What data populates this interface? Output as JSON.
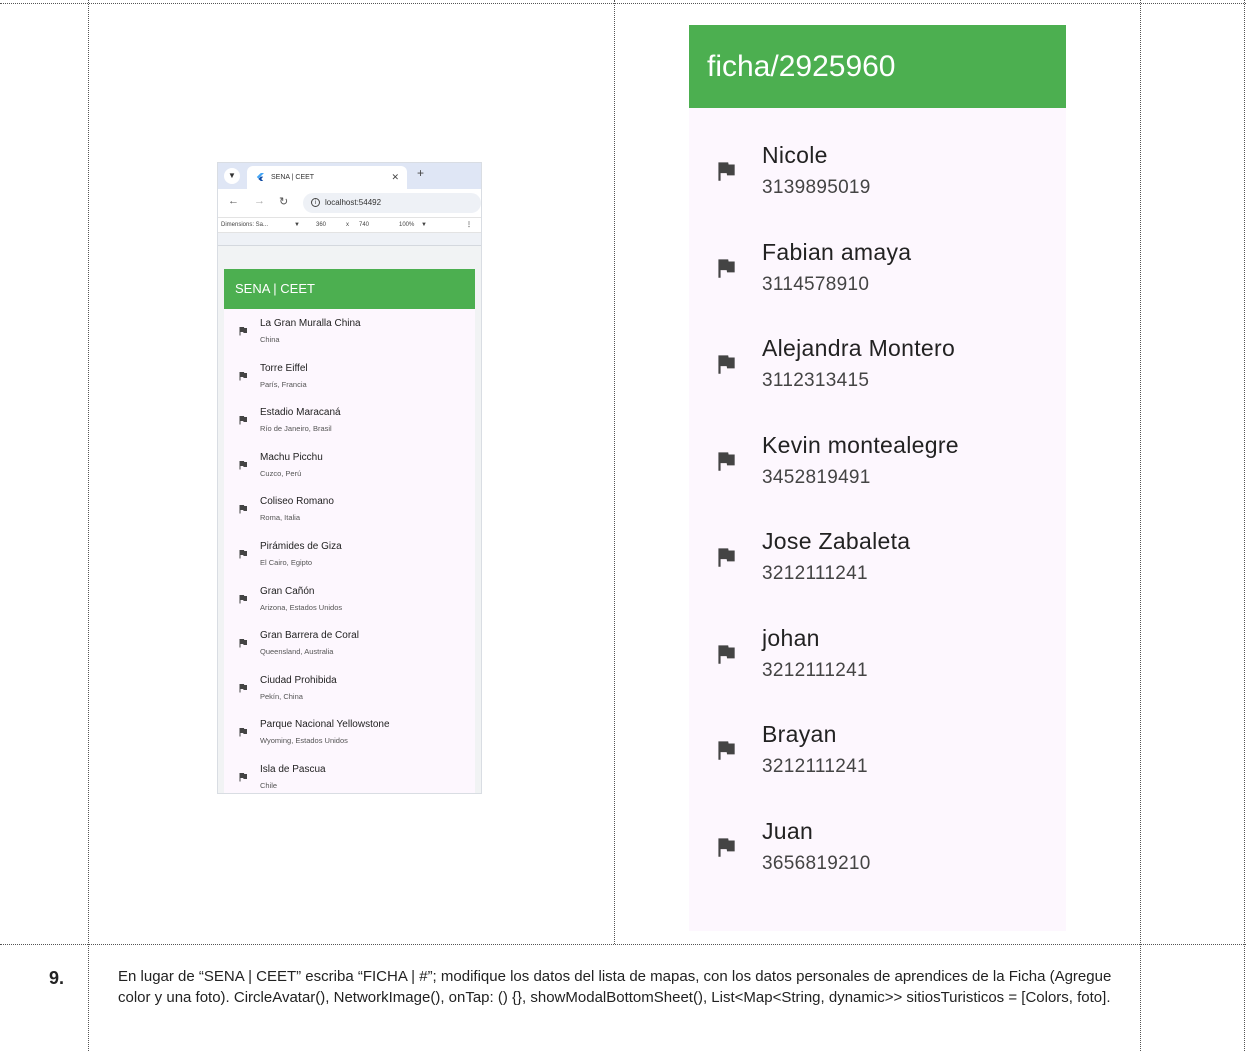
{
  "row_number": "9.",
  "instructions": "En lugar de “SENA | CEET” escriba “FICHA | #”; modifique los datos del lista de mapas, con los datos personales de aprendices de la Ficha (Agregue color y una foto). CircleAvatar(), NetworkImage(), onTap: () {}, showModalBottomSheet(),  List<Map<String, dynamic>> sitiosTuristicos = [Colors, foto].",
  "browser": {
    "tab_title": "SENA | CEET",
    "url": "localhost:54492",
    "devtools": {
      "dimensions": "Dimensions: Sa...",
      "width": "360",
      "times": "x",
      "height": "740",
      "zoom": "100%"
    },
    "app_title": "SENA | CEET",
    "items": [
      {
        "title": "La Gran Muralla China",
        "subtitle": "China"
      },
      {
        "title": "Torre Eiffel",
        "subtitle": "París, Francia"
      },
      {
        "title": "Estadio Maracaná",
        "subtitle": "Río de Janeiro, Brasil"
      },
      {
        "title": "Machu Picchu",
        "subtitle": "Cuzco, Perú"
      },
      {
        "title": "Coliseo Romano",
        "subtitle": "Roma, Italia"
      },
      {
        "title": "Pirámides de Giza",
        "subtitle": "El Cairo, Egipto"
      },
      {
        "title": "Gran Cañón",
        "subtitle": "Arizona, Estados Unidos"
      },
      {
        "title": "Gran Barrera de Coral",
        "subtitle": "Queensland, Australia"
      },
      {
        "title": "Ciudad Prohibida",
        "subtitle": "Pekín, China"
      },
      {
        "title": "Parque Nacional Yellowstone",
        "subtitle": "Wyoming, Estados Unidos"
      },
      {
        "title": "Isla de Pascua",
        "subtitle": "Chile"
      }
    ]
  },
  "ficha_app": {
    "title": "ficha/2925960",
    "items": [
      {
        "name": "Nicole",
        "phone": "3139895019"
      },
      {
        "name": "Fabian amaya",
        "phone": "3114578910"
      },
      {
        "name": "Alejandra Montero",
        "phone": "3112313415"
      },
      {
        "name": "Kevin montealegre",
        "phone": "3452819491"
      },
      {
        "name": "Jose Zabaleta",
        "phone": "3212111241"
      },
      {
        "name": "johan",
        "phone": "3212111241"
      },
      {
        "name": "Brayan",
        "phone": "3212111241"
      },
      {
        "name": "Juan",
        "phone": "3656819210"
      }
    ]
  },
  "colors": {
    "appbar_green": "#4caf50",
    "list_background": "#fdf7fe",
    "icon_color": "#444444"
  }
}
